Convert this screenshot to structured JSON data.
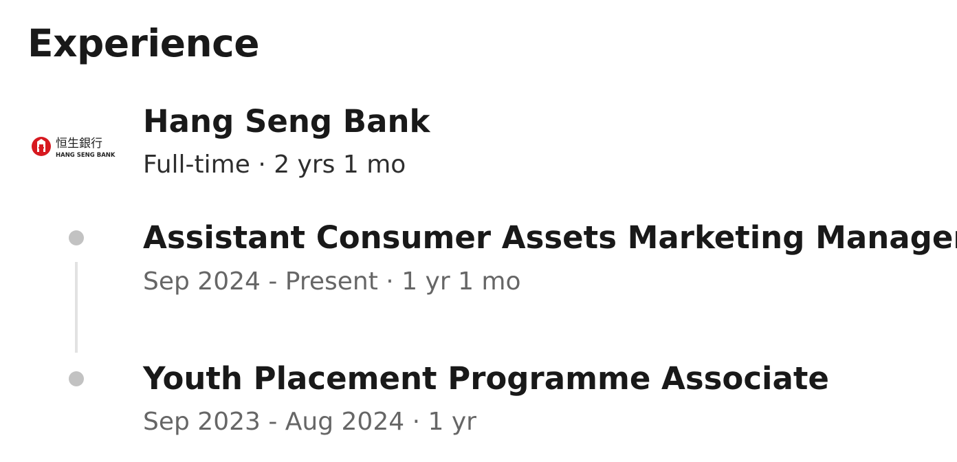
{
  "section": {
    "title": "Experience"
  },
  "company": {
    "name": "Hang Seng Bank",
    "employment_type": "Full-time · 2 yrs 1 mo",
    "logo": {
      "icon": "hang-seng-bank-logo",
      "chinese_text": "恒生銀行",
      "english_text": "HANG SENG BANK",
      "brand_color": "#d71920"
    }
  },
  "roles": [
    {
      "title": "Assistant Consumer Assets Marketing Manager",
      "dates": "Sep 2024 - Present · 1 yr 1 mo"
    },
    {
      "title": "Youth Placement Programme Associate",
      "dates": "Sep 2023 - Aug 2024 · 1 yr"
    }
  ]
}
